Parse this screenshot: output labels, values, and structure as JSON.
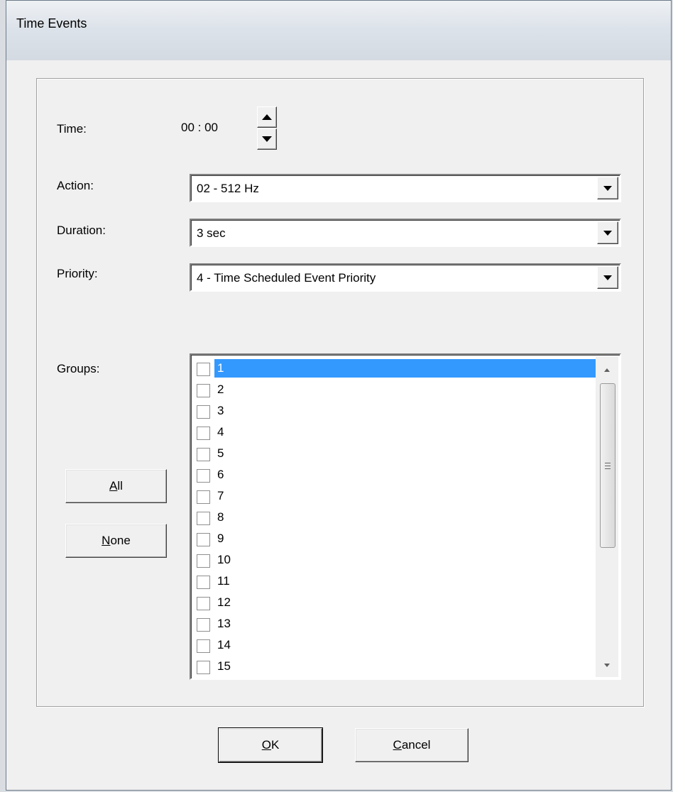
{
  "window": {
    "title": "Time Events"
  },
  "time": {
    "label": "Time:",
    "value": "00 :  00"
  },
  "action": {
    "label": "Action:",
    "value": "02 - 512 Hz"
  },
  "duration": {
    "label": "Duration:",
    "value": "3 sec"
  },
  "priority": {
    "label": "Priority:",
    "value": "4 - Time Scheduled Event Priority"
  },
  "groups": {
    "label": "Groups:",
    "items": [
      "1",
      "2",
      "3",
      "4",
      "5",
      "6",
      "7",
      "8",
      "9",
      "10",
      "11",
      "12",
      "13",
      "14",
      "15"
    ],
    "selected": "1"
  },
  "buttons": {
    "all": {
      "accel": "A",
      "rest": "ll"
    },
    "none": {
      "accel": "N",
      "rest": "one"
    },
    "ok": {
      "accel": "O",
      "rest": "K"
    },
    "cancel": {
      "accel": "C",
      "rest": "ancel"
    }
  },
  "colors": {
    "selection": "#3399ff",
    "dialog_bg": "#f0f0f0"
  }
}
